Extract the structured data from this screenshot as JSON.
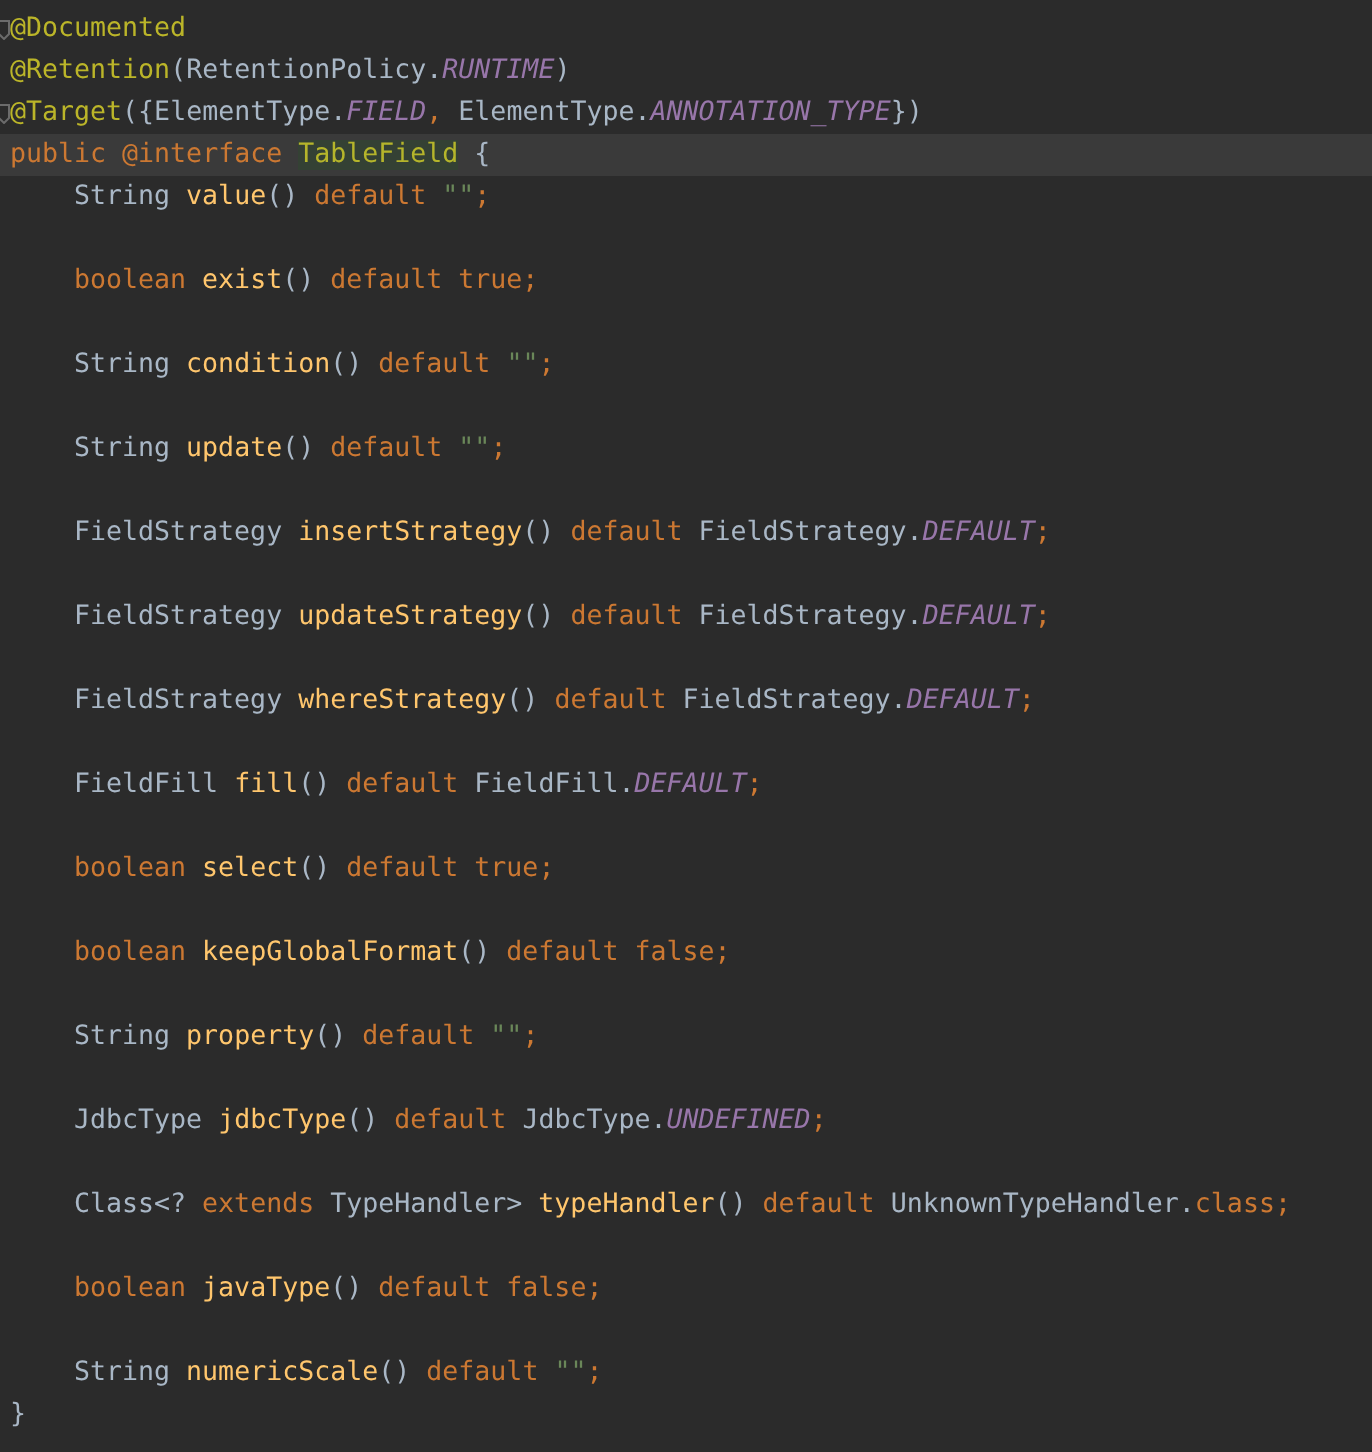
{
  "editor": {
    "annotations": [
      {
        "fold": true,
        "tokens": [
          {
            "kind": "annotation",
            "text": "@Documented"
          }
        ]
      },
      {
        "fold": false,
        "tokens": [
          {
            "kind": "annotation",
            "text": "@Retention"
          },
          {
            "kind": "plain",
            "text": "(RetentionPolicy."
          },
          {
            "kind": "constant",
            "text": "RUNTIME"
          },
          {
            "kind": "plain",
            "text": ")"
          }
        ]
      },
      {
        "fold": true,
        "tokens": [
          {
            "kind": "annotation",
            "text": "@Target"
          },
          {
            "kind": "plain",
            "text": "({ElementType."
          },
          {
            "kind": "constant",
            "text": "FIELD"
          },
          {
            "kind": "keyword",
            "text": ", "
          },
          {
            "kind": "plain",
            "text": "ElementType."
          },
          {
            "kind": "constant",
            "text": "ANNOTATION_TYPE"
          },
          {
            "kind": "plain",
            "text": "})"
          }
        ]
      }
    ],
    "declaration": {
      "fold": false,
      "current": true,
      "tokens": [
        {
          "kind": "keyword",
          "text": "public @interface "
        },
        {
          "kind": "declared",
          "text": "TableField"
        },
        {
          "kind": "plain",
          "text": " {"
        }
      ]
    },
    "members": [
      {
        "tokens": [
          {
            "kind": "plain",
            "text": "String "
          },
          {
            "kind": "method",
            "text": "value"
          },
          {
            "kind": "plain",
            "text": "() "
          },
          {
            "kind": "keyword",
            "text": "default "
          },
          {
            "kind": "string",
            "text": "\"\""
          },
          {
            "kind": "keyword",
            "text": ";"
          }
        ]
      },
      {
        "tokens": [
          {
            "kind": "keyword",
            "text": "boolean "
          },
          {
            "kind": "method",
            "text": "exist"
          },
          {
            "kind": "plain",
            "text": "() "
          },
          {
            "kind": "keyword",
            "text": "default true;"
          }
        ]
      },
      {
        "tokens": [
          {
            "kind": "plain",
            "text": "String "
          },
          {
            "kind": "method",
            "text": "condition"
          },
          {
            "kind": "plain",
            "text": "() "
          },
          {
            "kind": "keyword",
            "text": "default "
          },
          {
            "kind": "string",
            "text": "\"\""
          },
          {
            "kind": "keyword",
            "text": ";"
          }
        ]
      },
      {
        "tokens": [
          {
            "kind": "plain",
            "text": "String "
          },
          {
            "kind": "method",
            "text": "update"
          },
          {
            "kind": "plain",
            "text": "() "
          },
          {
            "kind": "keyword",
            "text": "default "
          },
          {
            "kind": "string",
            "text": "\"\""
          },
          {
            "kind": "keyword",
            "text": ";"
          }
        ]
      },
      {
        "tokens": [
          {
            "kind": "plain",
            "text": "FieldStrategy "
          },
          {
            "kind": "method",
            "text": "insertStrategy"
          },
          {
            "kind": "plain",
            "text": "() "
          },
          {
            "kind": "keyword",
            "text": "default "
          },
          {
            "kind": "plain",
            "text": "FieldStrategy."
          },
          {
            "kind": "constant",
            "text": "DEFAULT"
          },
          {
            "kind": "keyword",
            "text": ";"
          }
        ]
      },
      {
        "tokens": [
          {
            "kind": "plain",
            "text": "FieldStrategy "
          },
          {
            "kind": "method",
            "text": "updateStrategy"
          },
          {
            "kind": "plain",
            "text": "() "
          },
          {
            "kind": "keyword",
            "text": "default "
          },
          {
            "kind": "plain",
            "text": "FieldStrategy."
          },
          {
            "kind": "constant",
            "text": "DEFAULT"
          },
          {
            "kind": "keyword",
            "text": ";"
          }
        ]
      },
      {
        "tokens": [
          {
            "kind": "plain",
            "text": "FieldStrategy "
          },
          {
            "kind": "method",
            "text": "whereStrategy"
          },
          {
            "kind": "plain",
            "text": "() "
          },
          {
            "kind": "keyword",
            "text": "default "
          },
          {
            "kind": "plain",
            "text": "FieldStrategy."
          },
          {
            "kind": "constant",
            "text": "DEFAULT"
          },
          {
            "kind": "keyword",
            "text": ";"
          }
        ]
      },
      {
        "tokens": [
          {
            "kind": "plain",
            "text": "FieldFill "
          },
          {
            "kind": "method",
            "text": "fill"
          },
          {
            "kind": "plain",
            "text": "() "
          },
          {
            "kind": "keyword",
            "text": "default "
          },
          {
            "kind": "plain",
            "text": "FieldFill."
          },
          {
            "kind": "constant",
            "text": "DEFAULT"
          },
          {
            "kind": "keyword",
            "text": ";"
          }
        ]
      },
      {
        "tokens": [
          {
            "kind": "keyword",
            "text": "boolean "
          },
          {
            "kind": "method",
            "text": "select"
          },
          {
            "kind": "plain",
            "text": "() "
          },
          {
            "kind": "keyword",
            "text": "default true;"
          }
        ]
      },
      {
        "tokens": [
          {
            "kind": "keyword",
            "text": "boolean "
          },
          {
            "kind": "method",
            "text": "keepGlobalFormat"
          },
          {
            "kind": "plain",
            "text": "() "
          },
          {
            "kind": "keyword",
            "text": "default false;"
          }
        ]
      },
      {
        "tokens": [
          {
            "kind": "plain",
            "text": "String "
          },
          {
            "kind": "method",
            "text": "property"
          },
          {
            "kind": "plain",
            "text": "() "
          },
          {
            "kind": "keyword",
            "text": "default "
          },
          {
            "kind": "string",
            "text": "\"\""
          },
          {
            "kind": "keyword",
            "text": ";"
          }
        ]
      },
      {
        "tokens": [
          {
            "kind": "plain",
            "text": "JdbcType "
          },
          {
            "kind": "method",
            "text": "jdbcType"
          },
          {
            "kind": "plain",
            "text": "() "
          },
          {
            "kind": "keyword",
            "text": "default "
          },
          {
            "kind": "plain",
            "text": "JdbcType."
          },
          {
            "kind": "constant",
            "text": "UNDEFINED"
          },
          {
            "kind": "keyword",
            "text": ";"
          }
        ]
      },
      {
        "tokens": [
          {
            "kind": "plain",
            "text": "Class<? "
          },
          {
            "kind": "keyword",
            "text": "extends "
          },
          {
            "kind": "plain",
            "text": "TypeHandler> "
          },
          {
            "kind": "method",
            "text": "typeHandler"
          },
          {
            "kind": "plain",
            "text": "() "
          },
          {
            "kind": "keyword",
            "text": "default "
          },
          {
            "kind": "plain",
            "text": "UnknownTypeHandler."
          },
          {
            "kind": "keyword",
            "text": "class;"
          }
        ]
      },
      {
        "tokens": [
          {
            "kind": "keyword",
            "text": "boolean "
          },
          {
            "kind": "method",
            "text": "javaType"
          },
          {
            "kind": "plain",
            "text": "() "
          },
          {
            "kind": "keyword",
            "text": "default false;"
          }
        ]
      },
      {
        "tokens": [
          {
            "kind": "plain",
            "text": "String "
          },
          {
            "kind": "method",
            "text": "numericScale"
          },
          {
            "kind": "plain",
            "text": "() "
          },
          {
            "kind": "keyword",
            "text": "default "
          },
          {
            "kind": "string",
            "text": "\"\""
          },
          {
            "kind": "keyword",
            "text": ";"
          }
        ]
      }
    ],
    "closing": {
      "fold": false,
      "tokens": [
        {
          "kind": "plain",
          "text": "}"
        }
      ]
    }
  }
}
